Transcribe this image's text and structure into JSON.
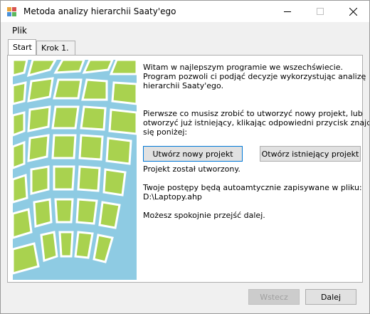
{
  "window": {
    "title": "Metoda analizy hierarchii Saaty'ego"
  },
  "menu": {
    "items": [
      "Plik"
    ]
  },
  "tabs": [
    {
      "label": "Start",
      "active": true
    },
    {
      "label": "Krok 1.",
      "active": false
    }
  ],
  "content": {
    "welcome_line1": "Witam w najlepszym programie we wszechświecie.",
    "welcome_line2": "Program pozwoli ci podjąć decyzje wykorzystując analizę",
    "welcome_line3": "hierarchii Saaty'ego.",
    "instr_line1": "Pierwsze co musisz zrobić to utworzyć nowy projekt, lub",
    "instr_line2": "otworzyć już istniejący, klikając odpowiedni przycisk znajdujący",
    "instr_line3": "się poniżej:",
    "status": "Projekt został utworzony.",
    "autosave_line1": "Twoje postępy będą autoamtycznie zapisywane w pliku:",
    "autosave_line2": "D:\\Laptopy.ahp",
    "continue": "Możesz spokojnie przejść dalej."
  },
  "buttons": {
    "create": "Utwórz nowy projekt",
    "open": "Otwórz istniejący projekt",
    "back": "Wstecz",
    "next": "Dalej"
  },
  "colors": {
    "lime": "#a9d24f",
    "sky": "#8ecbe3",
    "accent": "#0078d7"
  }
}
